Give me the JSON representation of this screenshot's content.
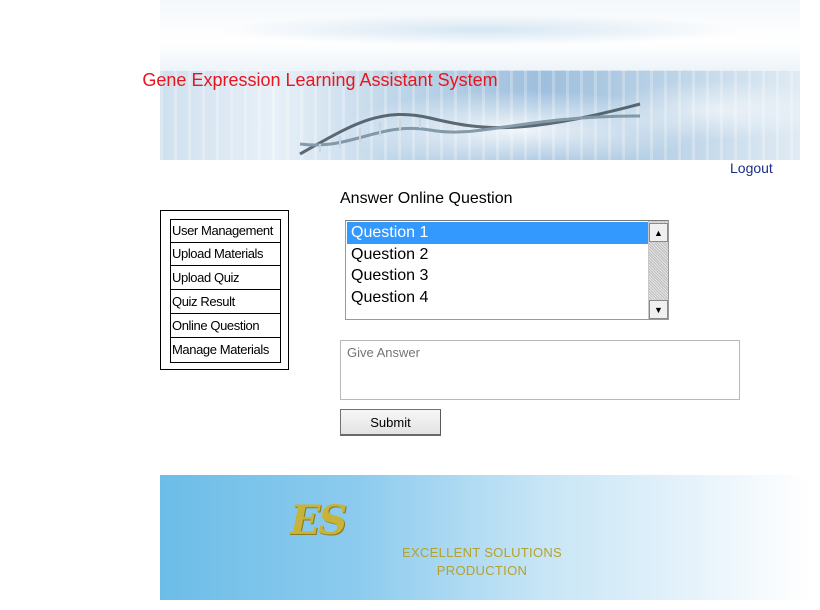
{
  "header": {
    "title": "Gene Expression Learning Assistant System",
    "logout_label": "Logout"
  },
  "sidebar": {
    "items": [
      {
        "label": "User Management"
      },
      {
        "label": "Upload Materials"
      },
      {
        "label": "Upload Quiz"
      },
      {
        "label": "Quiz Result"
      },
      {
        "label": "Online Question"
      },
      {
        "label": "Manage Materials"
      }
    ]
  },
  "main": {
    "section_title": "Answer Online Question",
    "questions": {
      "options": [
        "Question 1",
        "Question 2",
        "Question 3",
        "Question 4"
      ],
      "selected": "Question 1"
    },
    "answer": {
      "placeholder": "Give Answer",
      "value": ""
    },
    "submit_label": "Submit"
  },
  "footer": {
    "logo_mark": "ES",
    "line1": "EXCELLENT SOLUTIONS",
    "line2": "PRODUCTION"
  },
  "colors": {
    "title": "#e8141e",
    "link": "#1c2f86",
    "selection": "#3399ff",
    "footer_gold": "#b5a22c"
  }
}
